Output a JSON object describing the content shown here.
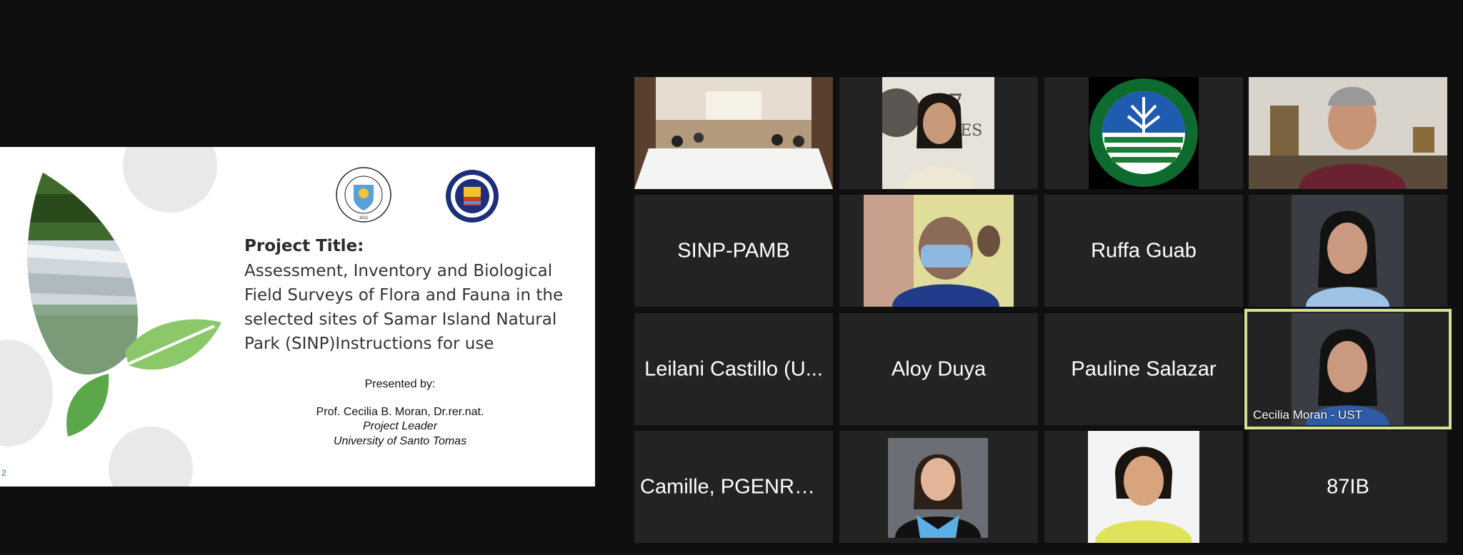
{
  "slide": {
    "title": "Project Title:",
    "body": "Assessment, Inventory and Biological Field Surveys of Flora and Fauna in the selected sites of Samar Island Natural Park (SINP)Instructions for use",
    "presented_by": "Presented by:",
    "presenter": "Prof. Cecilia B. Moran, Dr.rer.nat.",
    "role": "Project Leader",
    "institution": "University of Santo Tomas",
    "page_number": "2",
    "logo1_text": "PONTIFICAL AND ROYAL UNIVERSITY OF SANTO TOMAS MANILA 1611",
    "logo2_text": "PROVINCE OF SAMAR OFFICIAL SEAL",
    "colors": {
      "leaf_light": "#8cc86a",
      "leaf_dark": "#5aa84a",
      "circle": "#e9e9ec"
    }
  },
  "gallery": {
    "tiles": [
      {
        "kind": "video",
        "desc": "conference-room-video"
      },
      {
        "kind": "video",
        "desc": "woman-participant-video"
      },
      {
        "kind": "logo",
        "logo_text": "DEPARTMENT OF ENVIRONMENT AND NATURAL RESOURCES",
        "year": "• 1987 •"
      },
      {
        "kind": "video",
        "desc": "man-participant-video"
      },
      {
        "kind": "name",
        "name": "SINP-PAMB"
      },
      {
        "kind": "video",
        "desc": "masked-participant-video"
      },
      {
        "kind": "name",
        "name": "Ruffa Guab"
      },
      {
        "kind": "photo",
        "desc": "woman-portrait-photo"
      },
      {
        "kind": "name",
        "name": "Leilani Castillo (U..."
      },
      {
        "kind": "name",
        "name": "Aloy Duya"
      },
      {
        "kind": "name",
        "name": "Pauline Salazar"
      },
      {
        "kind": "photo",
        "label": "Cecilia Moran - UST",
        "active": true
      },
      {
        "kind": "name",
        "name": "Camille, PGENRO..."
      },
      {
        "kind": "photo",
        "desc": "graduation-portrait-photo"
      },
      {
        "kind": "photo",
        "desc": "yellow-shirt-portrait-photo"
      },
      {
        "kind": "name",
        "name": "87IB"
      }
    ],
    "active_color": "#d4e38f"
  }
}
